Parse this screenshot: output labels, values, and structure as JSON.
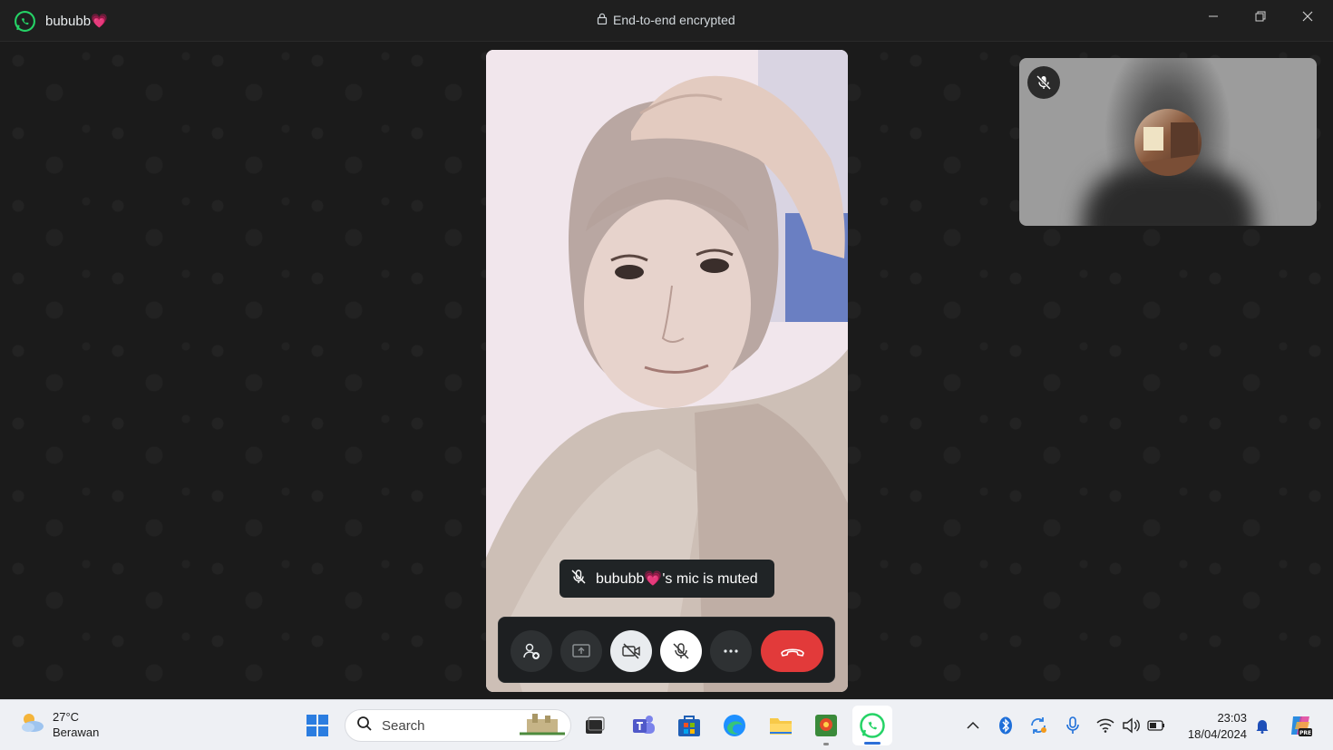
{
  "window": {
    "contact_name": "bububb💗",
    "encryption_label": "End-to-end encrypted"
  },
  "call": {
    "muted_toast": "bububb💗's mic is muted",
    "controls": [
      {
        "icon": "add-person-icon"
      },
      {
        "icon": "share-screen-icon"
      },
      {
        "icon": "camera-off-icon"
      },
      {
        "icon": "mic-off-icon"
      },
      {
        "icon": "more-icon"
      },
      {
        "icon": "end-call-icon"
      }
    ]
  },
  "taskbar": {
    "weather_temp": "27°C",
    "weather_desc": "Berawan",
    "search_label": "Search",
    "time": "23:03",
    "date": "18/04/2024"
  },
  "colors": {
    "end_call": "#e23a3a",
    "whatsapp_green": "#25d366",
    "accent": "#2d6fd8"
  }
}
